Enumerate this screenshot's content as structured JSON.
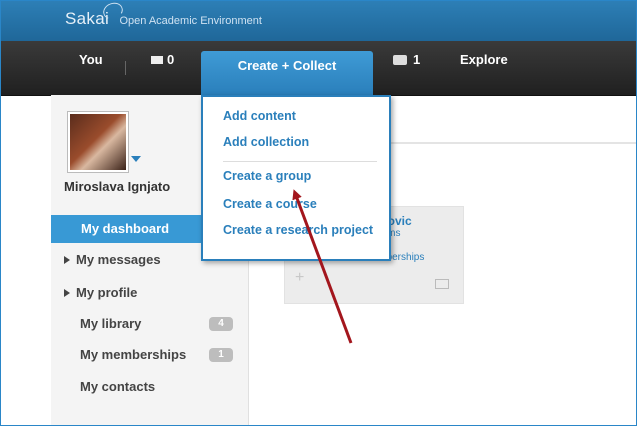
{
  "brand": {
    "logo": "Sakai",
    "tagline": "Open Academic Environment"
  },
  "nav": {
    "you": "You",
    "messages_count": "0",
    "create_collect": "Create + Collect",
    "tray_count": "1",
    "explore": "Explore"
  },
  "dropdown": {
    "items": [
      "Add content",
      "Add collection",
      "Create a group",
      "Create a course",
      "Create a research project"
    ]
  },
  "sidebar": {
    "user_name": "Miroslava Ignjato",
    "items": [
      {
        "label": "My dashboard"
      },
      {
        "label": "My messages"
      },
      {
        "label": "My profile"
      },
      {
        "label": "My library",
        "count": "4"
      },
      {
        "label": "My memberships",
        "count": "1"
      },
      {
        "label": "My contacts"
      }
    ]
  },
  "card": {
    "name": "vanovic",
    "lines": [
      "t items",
      "ts",
      "0 memberships"
    ]
  },
  "colors": {
    "accent": "#2a7fbb",
    "active": "#3899d5",
    "arrow": "#a3161d"
  }
}
